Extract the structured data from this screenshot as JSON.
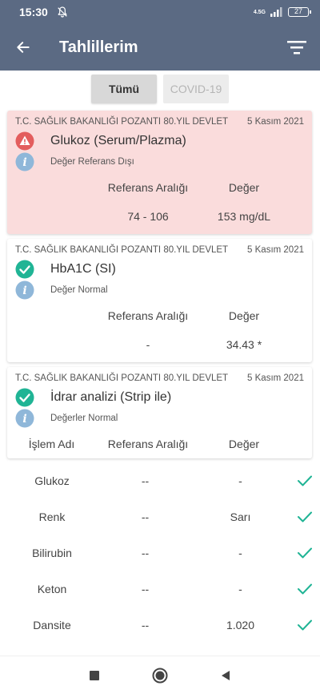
{
  "status_bar": {
    "time": "15:30",
    "network": "4.5G",
    "battery": "27"
  },
  "app_bar": {
    "title": "Tahlillerim"
  },
  "segments": [
    {
      "label": "Tümü",
      "active": true
    },
    {
      "label": "COVID-19",
      "active": false
    }
  ],
  "cards": [
    {
      "institution": "T.C. SAĞLIK BAKANLIĞI POZANTI 80.YIL DEVLET",
      "date": "5 Kasım 2021",
      "test_name": "Glukoz (Serum/Plazma)",
      "status": "Değer Referans Dışı",
      "icon": "warning-icon",
      "ref_label": "Referans Aralığı",
      "value_label": "Değer",
      "ref_value": "74 - 106",
      "value": "153 mg/dL"
    },
    {
      "institution": "T.C. SAĞLIK BAKANLIĞI POZANTI 80.YIL DEVLET",
      "date": "5 Kasım 2021",
      "test_name": "HbA1C (SI)",
      "status": "Değer Normal",
      "icon": "check-circle-icon",
      "ref_label": "Referans Aralığı",
      "value_label": "Değer",
      "ref_value": "-",
      "value": "34.43 *"
    },
    {
      "institution": "T.C. SAĞLIK BAKANLIĞI POZANTI 80.YIL DEVLET",
      "date": "5 Kasım 2021",
      "test_name": "İdrar analizi (Strip ile)",
      "status": "Değerler Normal",
      "icon": "check-circle-icon",
      "op_label": "İşlem Adı",
      "ref_label": "Referans Aralığı",
      "value_label": "Değer"
    }
  ],
  "urine_rows": [
    {
      "name": "Glukoz",
      "ref": "--",
      "value": "-"
    },
    {
      "name": "Renk",
      "ref": "--",
      "value": "Sarı"
    },
    {
      "name": "Bilirubin",
      "ref": "--",
      "value": "-"
    },
    {
      "name": "Keton",
      "ref": "--",
      "value": "-"
    },
    {
      "name": "Dansite",
      "ref": "--",
      "value": "1.020"
    }
  ],
  "colors": {
    "primary": "#5b6a83",
    "alert_bg": "#fadcdc",
    "warning": "#e35d5d",
    "success": "#20b495",
    "info": "#8fb7d9"
  }
}
